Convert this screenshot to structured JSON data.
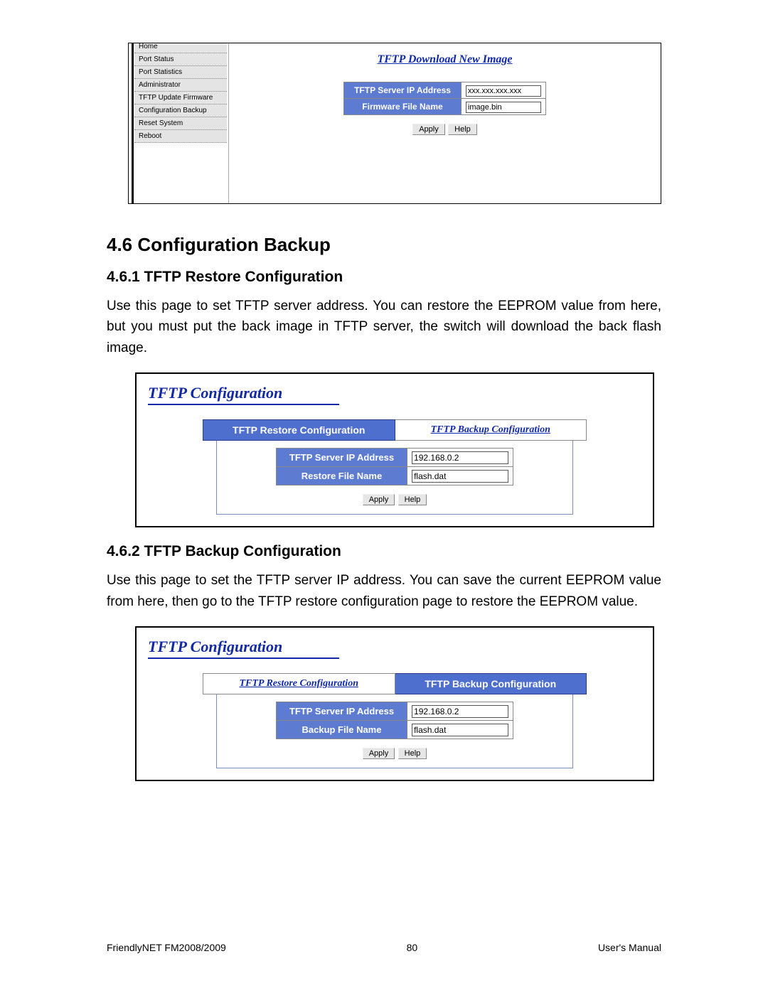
{
  "fig1": {
    "nav": [
      "Home",
      "Port Status",
      "Port Statistics",
      "Administrator",
      "TFTP Update Firmware",
      "Configuration Backup",
      "Reset System",
      "Reboot"
    ],
    "title": "TFTP Download New Image",
    "rows": [
      {
        "label": "TFTP Server IP Address",
        "value": "xxx.xxx.xxx.xxx"
      },
      {
        "label": "Firmware File Name",
        "value": "image.bin"
      }
    ],
    "apply": "Apply",
    "help": "Help"
  },
  "section_4_6": "4.6 Configuration Backup",
  "section_4_6_1": "4.6.1 TFTP Restore Configuration",
  "para_1": "Use this page to set TFTP server address. You can restore the EEPROM value from here, but you must put the back image in TFTP server, the switch will download the back flash image.",
  "fig2": {
    "title": "TFTP Configuration",
    "tabs": [
      "TFTP Restore Configuration",
      "TFTP Backup Configuration"
    ],
    "active": 0,
    "rows": [
      {
        "label": "TFTP Server IP Address",
        "value": "192.168.0.2"
      },
      {
        "label": "Restore File Name",
        "value": "flash.dat"
      }
    ],
    "apply": "Apply",
    "help": "Help"
  },
  "section_4_6_2": "4.6.2 TFTP Backup Configuration",
  "para_2": "Use this page to set the TFTP server IP address. You can save the current EEPROM value from here, then go to the TFTP restore configuration page to restore the EEPROM value.",
  "fig3": {
    "title": "TFTP Configuration",
    "tabs": [
      "TFTP Restore Configuration",
      "TFTP Backup Configuration"
    ],
    "active": 1,
    "rows": [
      {
        "label": "TFTP Server IP Address",
        "value": "192.168.0.2"
      },
      {
        "label": "Backup File Name",
        "value": "flash.dat"
      }
    ],
    "apply": "Apply",
    "help": "Help"
  },
  "footer": {
    "left": "FriendlyNET FM2008/2009",
    "center": "80",
    "right": "User's Manual"
  }
}
